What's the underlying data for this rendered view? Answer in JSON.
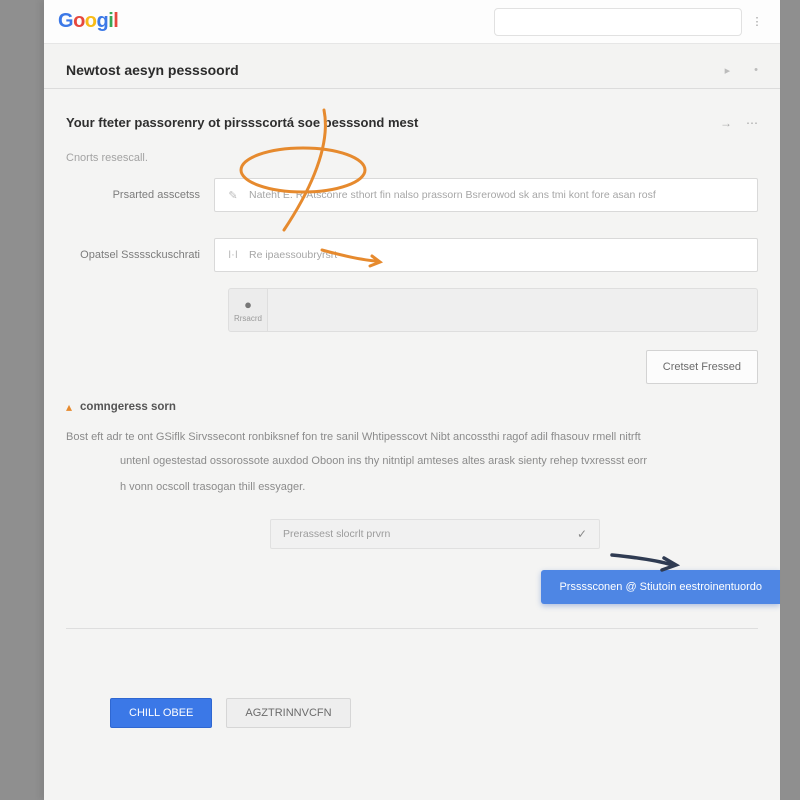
{
  "brand": {
    "g1": "G",
    "o1": "o",
    "o2": "o",
    "g2": "g",
    "i": "i",
    "l": "l"
  },
  "header": {
    "search_placeholder": "",
    "side_glyph": "⋮"
  },
  "title": {
    "text": "Newtost aesyn pesssoord",
    "right_a": "▸",
    "right_b": "•"
  },
  "section": {
    "heading": "Your fteter passorenry ot pirssscortá soe pesssond mest",
    "right_a": "→",
    "right_b": "⋯"
  },
  "hint1": "Cnorts resescall.",
  "field1": {
    "label": "Prsarted asscetss",
    "icon": "✎",
    "placeholder": "Nateht E. RfAtsconre sthort fin nalso prassorn Bsrerowod sk ans tmi kont fore asan rosf"
  },
  "field2": {
    "label": "Opatsel Sssssckuschrati",
    "icon": "I·I",
    "placeholder": "Re ipaessoubryrsrt"
  },
  "keypad": {
    "caption": "Rrsacrd"
  },
  "create_btn": "Cretset Fressed",
  "congrats": "comngeress sorn",
  "explain_line1": "Bost eft adr te ont GSiflk Sirvssecont ronbiksnef fon tre sanil Whtipesscovt Nibt ancossthi ragof adil fhasouv rmell nitrft",
  "explain_line2": "untenl ogestestad ossorossote auxdod Oboon ins thy nitntipl amteses altes arask sienty rehep tvxressst eorr",
  "explain_line3": "h vonn ocscoll trasogan thill essyager.",
  "dropdown": {
    "label": "Prerassest slocrlt prvrn",
    "check": "✓"
  },
  "toast": "Prssssconen @ Stiutoin eestroinentuordo",
  "footer": {
    "primary": "CHILL OBEE",
    "secondary": "AGZTRINNVCFN"
  }
}
